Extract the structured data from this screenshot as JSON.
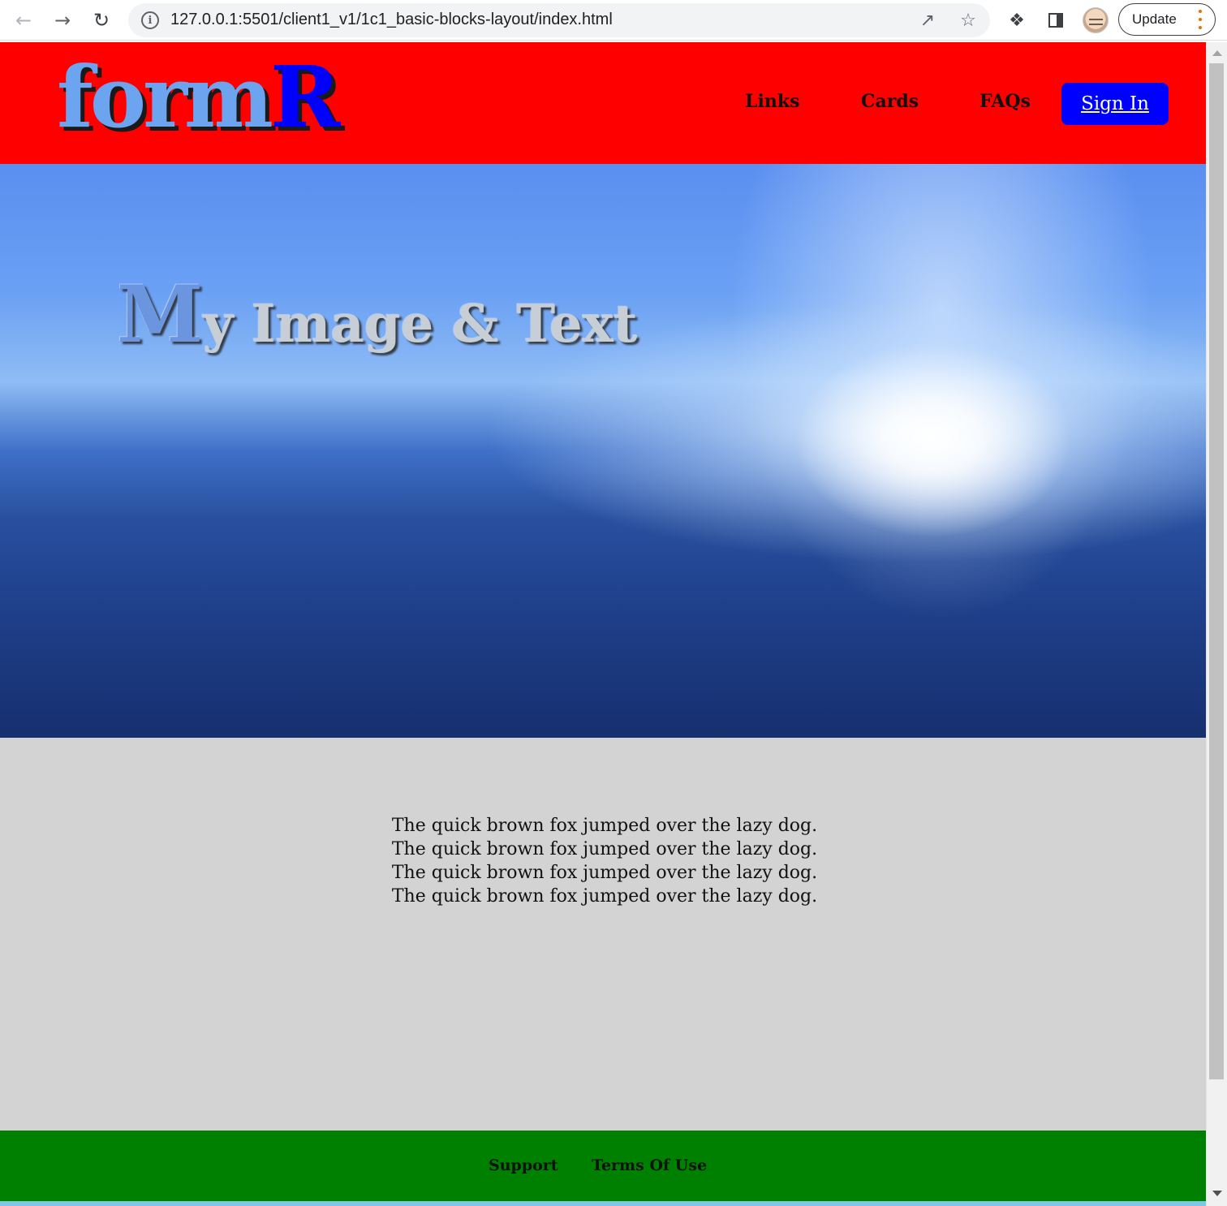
{
  "browser": {
    "url": "127.0.0.1:5501/client1_v1/1c1_basic-blocks-layout/index.html",
    "update_label": "Update",
    "icons": {
      "back": "arrow-left-icon",
      "forward": "arrow-right-icon",
      "reload": "reload-icon",
      "info": "info-icon",
      "share": "share-icon",
      "bookmark": "star-icon",
      "extensions": "puzzle-icon",
      "side_panel": "side-panel-icon",
      "profile": "avatar",
      "menu": "kebab-menu-icon"
    }
  },
  "header": {
    "logo_part1": "form",
    "logo_part2": "R",
    "nav": {
      "links": "Links",
      "cards": "Cards",
      "faqs": "FAQs"
    },
    "signin_label": "Sign In"
  },
  "hero": {
    "title_initial": "M",
    "title_rest": "y Image & Text"
  },
  "content": {
    "lines": [
      "The quick brown fox jumped over the lazy dog.",
      "The quick brown fox jumped over the lazy dog.",
      "The quick brown fox jumped over the lazy dog.",
      "The quick brown fox jumped over the lazy dog."
    ]
  },
  "footer": {
    "support": "Support",
    "terms": "Terms Of Use"
  },
  "colors": {
    "header_bg": "#ff0000",
    "signin_bg": "#0000ff",
    "content_bg": "#d3d3d3",
    "footer_bg": "#008000",
    "logo_light": "#6ca4f0",
    "logo_dark": "#0000ff"
  }
}
